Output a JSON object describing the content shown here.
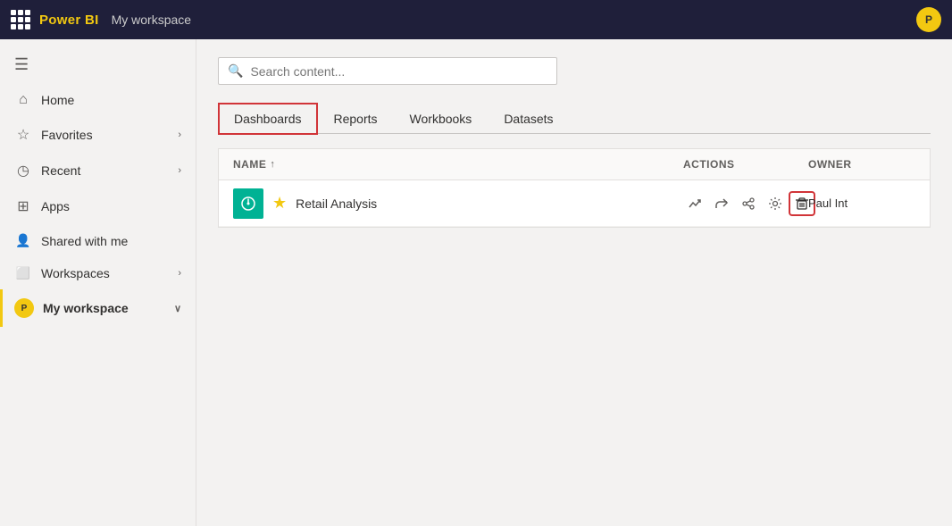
{
  "topbar": {
    "brand": "Power BI",
    "workspace": "My workspace",
    "avatar_initials": "P"
  },
  "sidebar": {
    "toggle_icon": "☰",
    "items": [
      {
        "id": "home",
        "label": "Home",
        "icon": "⌂",
        "has_chevron": false
      },
      {
        "id": "favorites",
        "label": "Favorites",
        "icon": "☆",
        "has_chevron": true
      },
      {
        "id": "recent",
        "label": "Recent",
        "icon": "◷",
        "has_chevron": true
      },
      {
        "id": "apps",
        "label": "Apps",
        "icon": "⊞",
        "has_chevron": false
      },
      {
        "id": "shared",
        "label": "Shared with me",
        "icon": "👤",
        "has_chevron": false
      },
      {
        "id": "workspaces",
        "label": "Workspaces",
        "icon": "⬜",
        "has_chevron": true
      },
      {
        "id": "my-workspace",
        "label": "My workspace",
        "icon": "avatar",
        "has_chevron": true,
        "is_active": true
      }
    ]
  },
  "content": {
    "search_placeholder": "Search content...",
    "tabs": [
      {
        "id": "dashboards",
        "label": "Dashboards",
        "active": true
      },
      {
        "id": "reports",
        "label": "Reports",
        "active": false
      },
      {
        "id": "workbooks",
        "label": "Workbooks",
        "active": false
      },
      {
        "id": "datasets",
        "label": "Datasets",
        "active": false
      }
    ],
    "table": {
      "columns": {
        "name": "NAME",
        "actions": "ACTIONS",
        "owner": "OWNER"
      },
      "rows": [
        {
          "id": 1,
          "name": "Retail Analysis",
          "owner": "Paul Int",
          "starred": true,
          "icon": "↻"
        }
      ]
    }
  },
  "icons": {
    "search": "🔍",
    "sort_asc": "↑",
    "analytics": "↗",
    "share": "↗",
    "share2": "⤢",
    "settings": "⚙",
    "delete": "🗑",
    "dashboard_icon": "↺"
  }
}
